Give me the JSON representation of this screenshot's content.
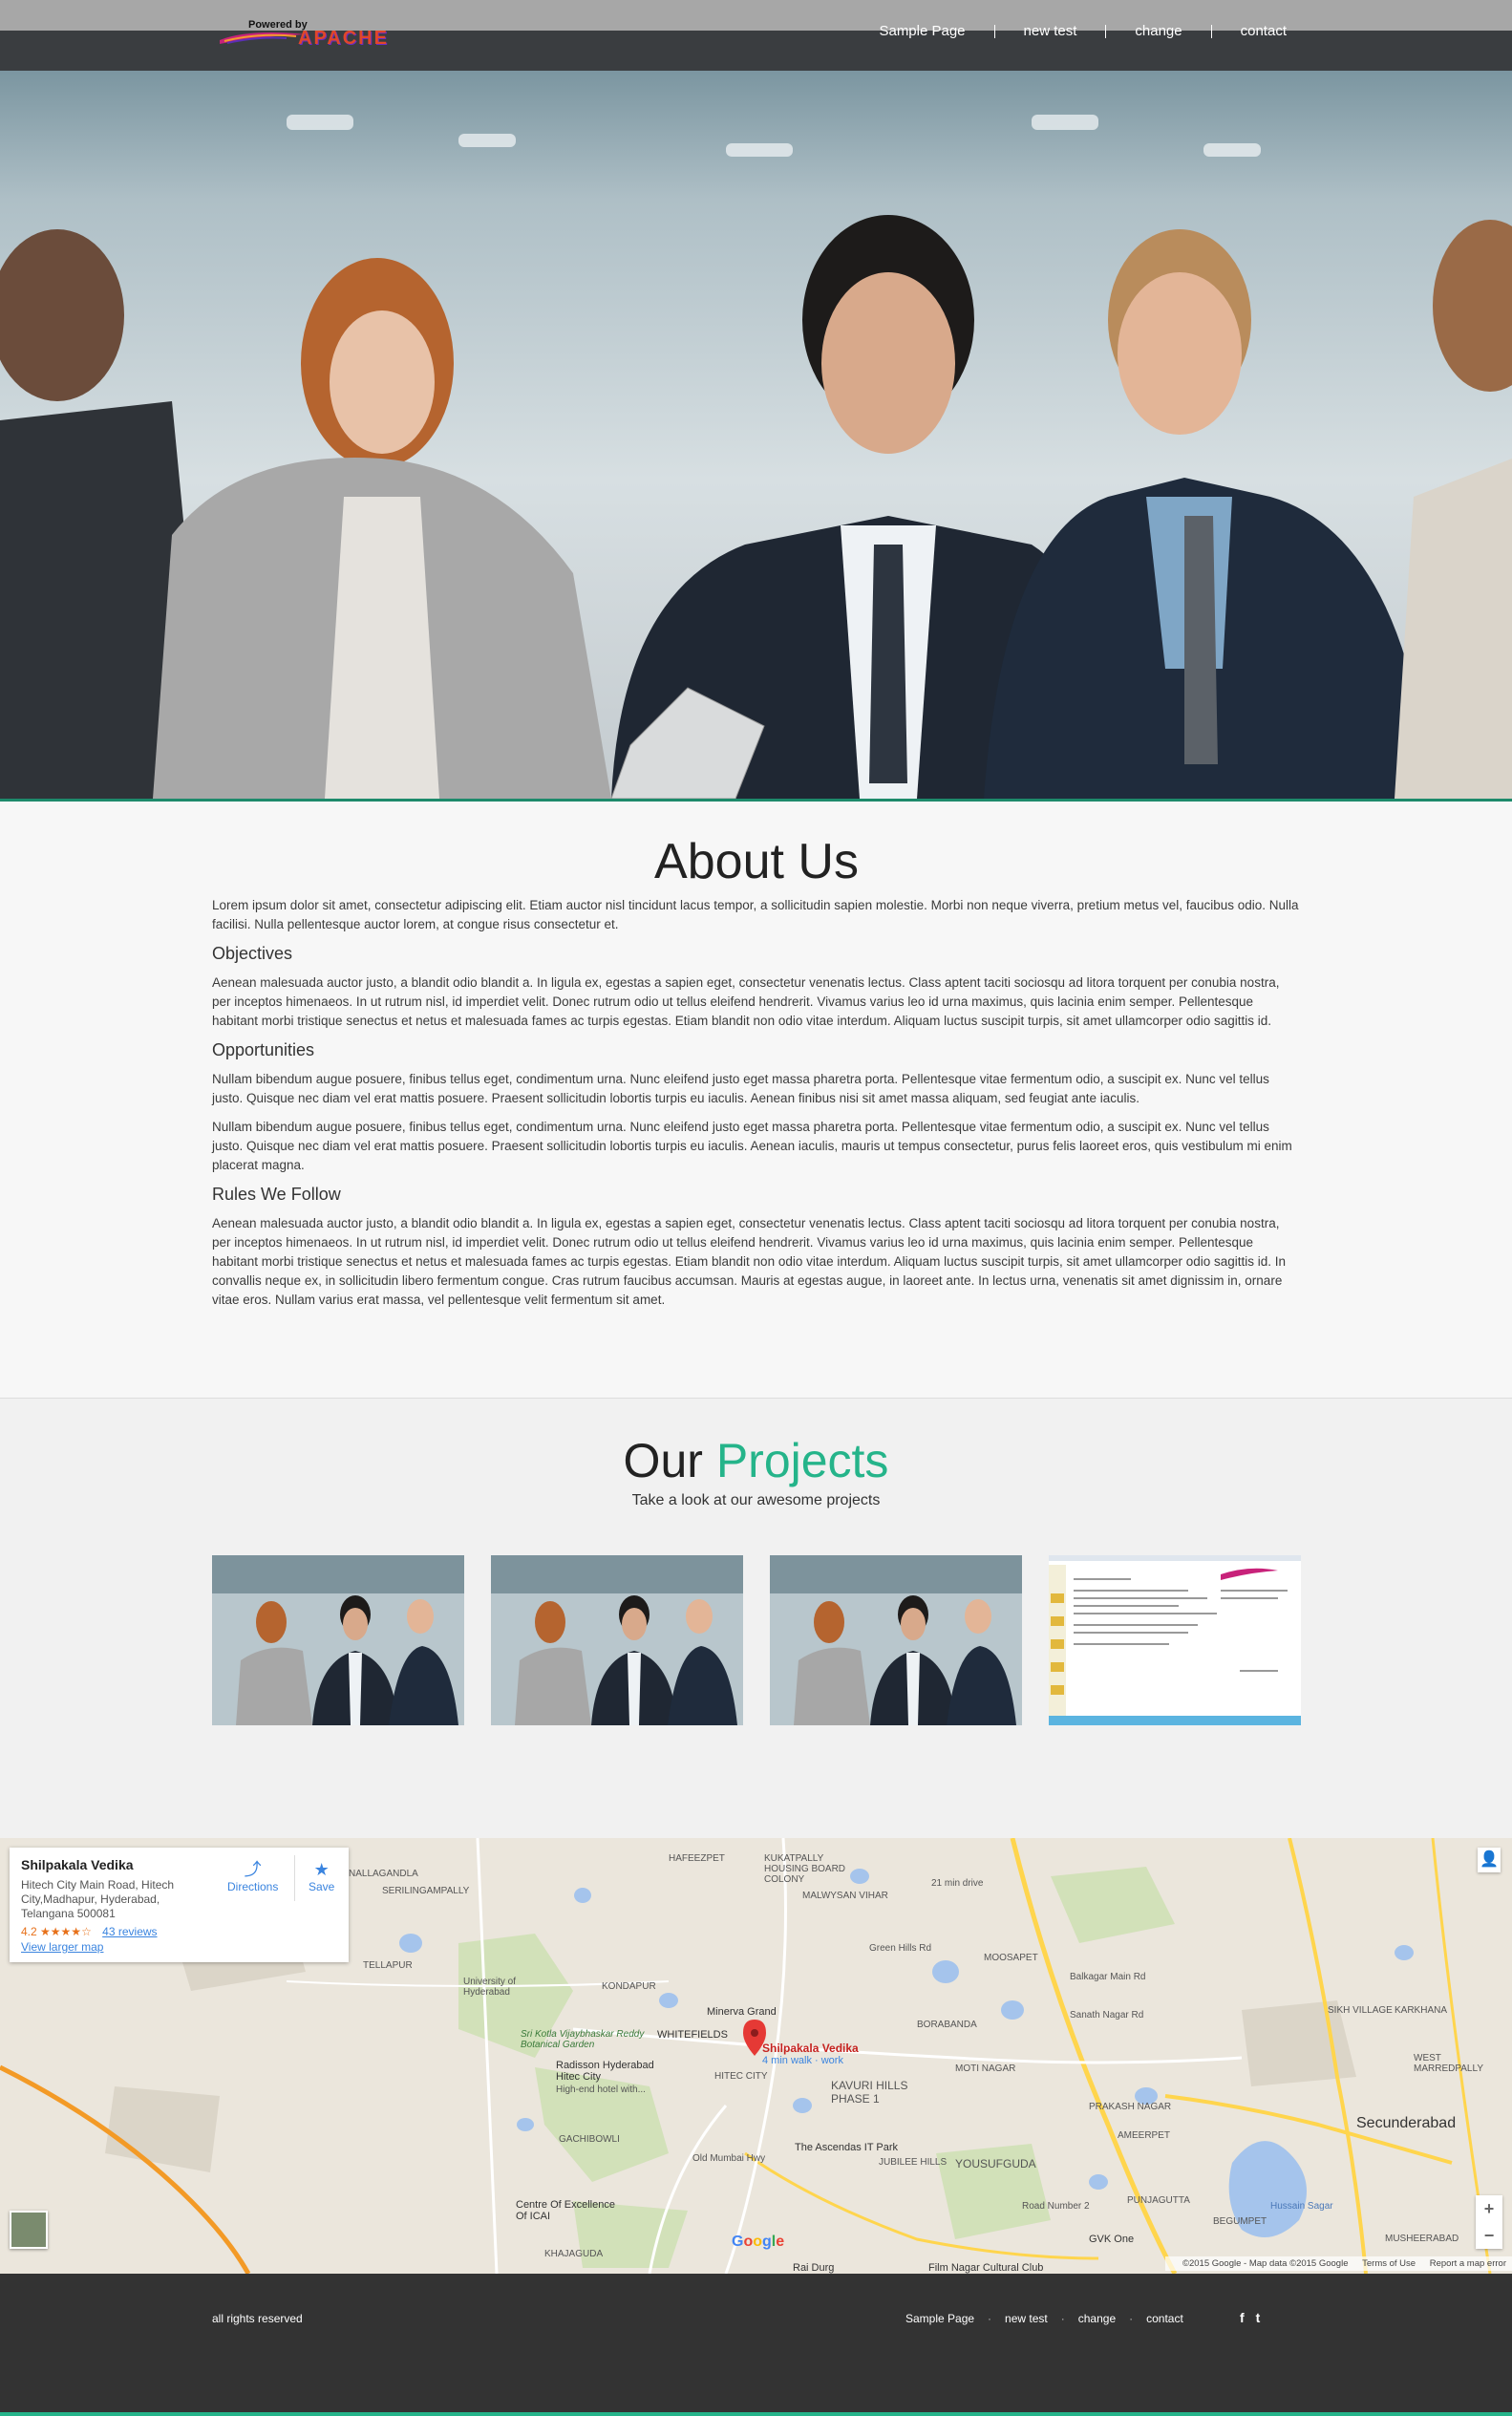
{
  "header": {
    "logo_powered": "Powered by",
    "logo_word": "APACHE",
    "nav": [
      "Sample Page",
      "new test",
      "change",
      "contact"
    ]
  },
  "about": {
    "title": "About Us",
    "intro": "Lorem ipsum dolor sit amet, consectetur adipiscing elit. Etiam auctor nisl tincidunt lacus tempor, a sollicitudin sapien molestie. Morbi non neque viverra, pretium metus vel, faucibus odio. Nulla facilisi. Nulla pellentesque auctor lorem, at congue risus consectetur et.",
    "sections": [
      {
        "heading": "Objectives",
        "paragraphs": [
          "Aenean malesuada auctor justo, a blandit odio blandit a. In ligula ex, egestas a sapien eget, consectetur venenatis lectus. Class aptent taciti sociosqu ad litora torquent per conubia nostra, per inceptos himenaeos. In ut rutrum nisl, id imperdiet velit. Donec rutrum odio ut tellus eleifend hendrerit. Vivamus varius leo id urna maximus, quis lacinia enim semper. Pellentesque habitant morbi tristique senectus et netus et malesuada fames ac turpis egestas. Etiam blandit non odio vitae interdum. Aliquam luctus suscipit turpis, sit amet ullamcorper odio sagittis id."
        ]
      },
      {
        "heading": "Opportunities",
        "paragraphs": [
          "Nullam bibendum augue posuere, finibus tellus eget, condimentum urna. Nunc eleifend justo eget massa pharetra porta. Pellentesque vitae fermentum odio, a suscipit ex. Nunc vel tellus justo. Quisque nec diam vel erat mattis posuere. Praesent sollicitudin lobortis turpis eu iaculis. Aenean finibus nisi sit amet massa aliquam, sed feugiat ante iaculis.",
          "Nullam bibendum augue posuere, finibus tellus eget, condimentum urna. Nunc eleifend justo eget massa pharetra porta. Pellentesque vitae fermentum odio, a suscipit ex. Nunc vel tellus justo. Quisque nec diam vel erat mattis posuere. Praesent sollicitudin lobortis turpis eu iaculis. Aenean iaculis, mauris ut tempus consectetur, purus felis laoreet eros, quis vestibulum mi enim placerat magna."
        ]
      },
      {
        "heading": "Rules We Follow",
        "paragraphs": [
          "Aenean malesuada auctor justo, a blandit odio blandit a. In ligula ex, egestas a sapien eget, consectetur venenatis lectus. Class aptent taciti sociosqu ad litora torquent per conubia nostra, per inceptos himenaeos. In ut rutrum nisl, id imperdiet velit. Donec rutrum odio ut tellus eleifend hendrerit. Vivamus varius leo id urna maximus, quis lacinia enim semper. Pellentesque habitant morbi tristique senectus et netus et malesuada fames ac turpis egestas. Etiam blandit non odio vitae interdum. Aliquam luctus suscipit turpis, sit amet ullamcorper odio sagittis id. In convallis neque ex, in sollicitudin libero fermentum congue. Cras rutrum faucibus accumsan. Mauris at egestas augue, in laoreet ante. In lectus urna, venenatis sit amet dignissim in, ornare vitae eros. Nullam varius erat massa, vel pellentesque velit fermentum sit amet."
        ]
      }
    ]
  },
  "projects": {
    "title_plain": "Our",
    "title_accent": "Projects",
    "subtitle": "Take a look at our awesome projects",
    "accent_color": "#25b48a"
  },
  "map": {
    "place_name": "Shilpakala Vedika",
    "address": "Hitech City Main Road, Hitech City,Madhapur, Hyderabad, Telangana 500081",
    "rating": "4.2",
    "stars": "★★★★☆",
    "reviews": "43 reviews",
    "view_larger": "View larger map",
    "directions": "Directions",
    "save": "Save",
    "pin_label": "Shilpakala Vedika",
    "pin_sub": "4 min walk · work",
    "labels": [
      "HAFEEZPET",
      "KUKATPALLY HOUSING BOARD COLONY",
      "MALWYSAN VIHAR",
      "21 min drive",
      "Green Hills Rd",
      "MOOSAPET",
      "Balkagar Main Rd",
      "Minerva Grand",
      "KONDAPUR",
      "University of Hyderabad",
      "Sri Kotla Vijaybhaskar Reddy Botanical Garden",
      "WHITEFIELDS",
      "Radisson Hyderabad Hitec City",
      "High-end hotel with...",
      "HITEC CITY",
      "KAVURI HILLS PHASE 1",
      "BORABANDA",
      "MOTI NAGAR",
      "PRAKASH NAGAR",
      "The Ascendas IT Park",
      "YOUSUFGUDA",
      "JUBILEE HILLS",
      "GACHIBOWLI",
      "Centre Of Excellence Of ICAI",
      "KHAJAGUDA",
      "Film Nagar Cultural Club",
      "Rai Durg",
      "GVK One",
      "PUNJAGUTTA",
      "AMEERPET",
      "BEGUMPET",
      "Secunderabad",
      "Hussain Sagar",
      "MUSHEERABAD",
      "SIKH VILLAGE",
      "KARKHANA",
      "WEST MARREDPALLY",
      "SERILINGAMPALLY",
      "TELLAPUR",
      "NALLAGANDLA",
      "Old Mumbai Hwy",
      "Road Number 2",
      "Sanath Nagar Rd"
    ],
    "attribution": "©2015 Google - Map data ©2015 Google",
    "terms": "Terms of Use",
    "report": "Report a map error",
    "google": [
      "G",
      "o",
      "o",
      "g",
      "l",
      "e"
    ]
  },
  "footer": {
    "copyright": "all rights reserved",
    "nav": [
      "Sample Page",
      "new test",
      "change",
      "contact"
    ],
    "social": [
      "f",
      "t"
    ]
  }
}
